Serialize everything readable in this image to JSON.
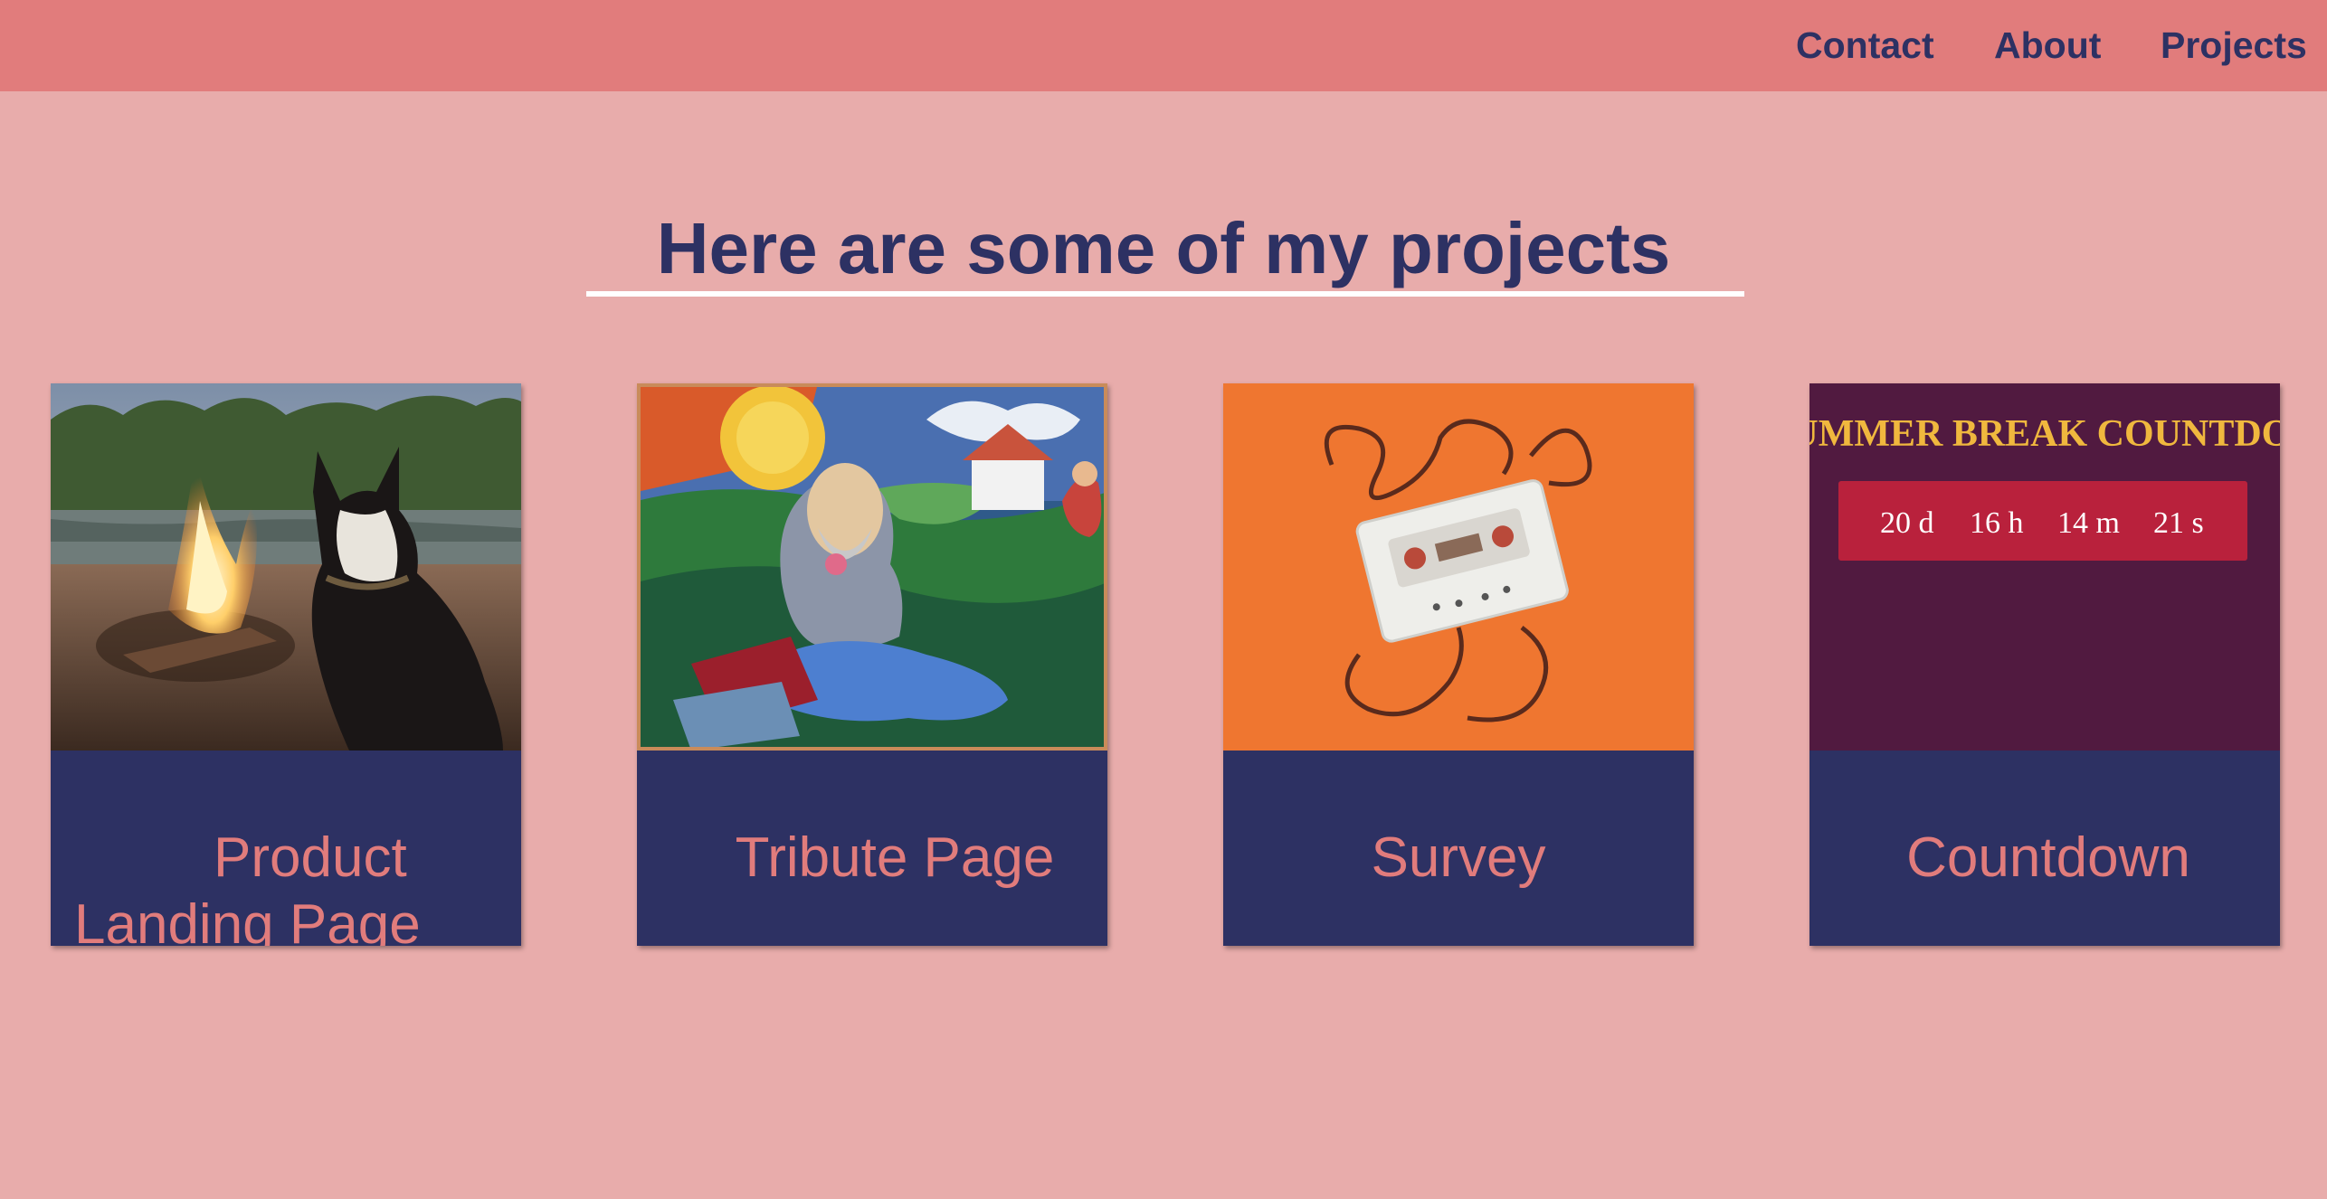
{
  "nav": {
    "contact": "Contact",
    "about": "About",
    "projects": "Projects"
  },
  "main": {
    "heading": "Here are some of my projects"
  },
  "projects": [
    {
      "title": "Product Landing Page",
      "thumbnail": "dog-by-campfire-photo"
    },
    {
      "title": "Tribute Page",
      "thumbnail": "colorful-painting-of-old-man"
    },
    {
      "title": "Survey",
      "thumbnail": "cassette-tape-on-orange-photo"
    },
    {
      "title": "Countdown",
      "thumbnail": "countdown-app-preview",
      "preview": {
        "banner": "SUMMER BREAK COUNTDOWN",
        "days": "20 d",
        "hours": "16 h",
        "minutes": "14 m",
        "seconds": "21 s"
      }
    }
  ],
  "colors": {
    "background": "#e8acab",
    "navbar": "#e17c7c",
    "navy": "#2d3163",
    "accent_text": "#e17c7c",
    "countdown_bg": "#511a40",
    "countdown_box": "#b9213c",
    "countdown_banner": "#f0b83e"
  }
}
